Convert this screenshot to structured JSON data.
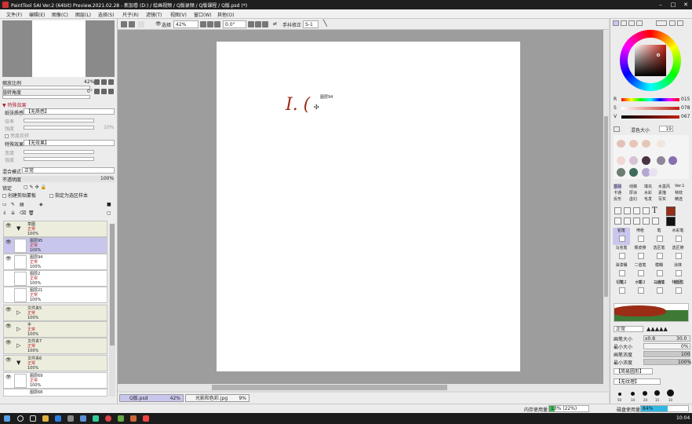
{
  "window": {
    "title": "PaintTool SAI Ver.2 (64bit) Preview.2021.02.28 - 新加卷 (D:) / 绘画视频 / Q版录频 / Q版课程 / Q版.psd (*)"
  },
  "menu": [
    "文件(F)",
    "编辑(E)",
    "图像(C)",
    "图层(L)",
    "选择(S)",
    "尺子(R)",
    "滤镜(T)",
    "视图(V)",
    "窗口(W)",
    "其他(O)"
  ],
  "navigator": {
    "zoom_label": "缩放比例",
    "zoom_value": "42%",
    "angle_label": "旋转角度",
    "angle_value": "0°"
  },
  "effects": {
    "section_title": "▼ 特殊效果",
    "paper_label": "纸张质感",
    "paper_value": "【无质感】",
    "scale_label": "倍率",
    "strength_label": "强度",
    "strength_value": "10%",
    "brightness_label": "亮度反转",
    "brightness_value": "100",
    "effect_label": "特殊效果",
    "effect_value": "【无效果】",
    "width_label": "宽度",
    "strength2_label": "强度"
  },
  "layer_props": {
    "blend_label": "混合模式",
    "blend_value": "正常",
    "opacity_label": "不透明度",
    "opacity_value": "100%",
    "lock_label": "锁定",
    "clip_label": "创建剪贴蒙板",
    "ref_label": "指定为选区样本"
  },
  "layers": [
    {
      "name": "草图",
      "mode": "正常",
      "opacity": "100%",
      "type": "folder"
    },
    {
      "name": "图层95",
      "mode": "正常",
      "opacity": "100%",
      "type": "selected"
    },
    {
      "name": "图层94",
      "mode": "正常",
      "opacity": "100%",
      "type": "layer"
    },
    {
      "name": "图层2",
      "mode": "正常",
      "opacity": "100%",
      "type": "layer"
    },
    {
      "name": "图层21",
      "mode": "正常",
      "opacity": "100%",
      "type": "layer"
    },
    {
      "name": "文件夹5",
      "mode": "正常",
      "opacity": "100%",
      "type": "folder"
    },
    {
      "name": "手",
      "mode": "正常",
      "opacity": "100%",
      "type": "folder"
    },
    {
      "name": "文件夹7",
      "mode": "正常",
      "opacity": "100%",
      "type": "folder"
    },
    {
      "name": "文件夹6",
      "mode": "正常",
      "opacity": "100%",
      "type": "folder"
    },
    {
      "name": "图层69",
      "mode": "正常",
      "opacity": "100%",
      "type": "layer"
    },
    {
      "name": "图层68",
      "mode": "",
      "opacity": "",
      "type": "layer"
    }
  ],
  "canvas_toolbar": {
    "select_label": "选择",
    "zoom": "42%",
    "angle": "0.0°",
    "stabilizer_label": "手抖修正",
    "stabilizer_value": "S-1"
  },
  "canvas": {
    "tooltip": "图层94",
    "sketch_text": "I. ("
  },
  "file_tabs": [
    {
      "name": "Q版.psd",
      "zoom": "42%"
    },
    {
      "name": "光影和色彩.jpg",
      "zoom": "9%"
    }
  ],
  "color": {
    "r_label": "R",
    "r_value": "015",
    "g_label": "S",
    "g_value": "078",
    "b_label": "V",
    "b_value": "067",
    "swatch_label": "混色大小",
    "swatch_value": "19",
    "main_color": "#9b2c15"
  },
  "tool_tabs": [
    "基础",
    "线稿",
    "填充",
    "水墨风",
    "Ver.1",
    "卡通",
    "厚涂",
    "水彩",
    "素描",
    "特效",
    "反形",
    "虚幻",
    "毛发",
    "写实",
    "精选"
  ],
  "brushes": [
    "铅笔",
    "喷枪",
    "笔",
    "水彩笔",
    "马克笔",
    "橡皮擦",
    "选区笔",
    "选区擦",
    "油漆桶",
    "二值笔",
    "模糊",
    "涂抹",
    "铅笔2",
    "水彩2",
    "马克2",
    "特效笔",
    "笔",
    "笔",
    "二值笔",
    "选区"
  ],
  "brush_settings": {
    "blend_value": "正常",
    "size_label": "画笔大小",
    "size_mult": "x0.8",
    "size_value": "30.0",
    "min_size_label": "最小大小",
    "min_size_value": "0%",
    "density_label": "画笔浓度",
    "density_value": "100",
    "min_density_label": "最小浓度",
    "min_density_value": "100%",
    "shape_value": "【简易圆形】",
    "texture_value": "【无纹理】",
    "dot_sizes": [
      "50",
      "14",
      "24",
      "15",
      "10"
    ]
  },
  "status": {
    "memory_label": "内存使用量",
    "memory_value": "13% (22%)",
    "disk_label": "磁盘使用量",
    "disk_value": "84%"
  },
  "taskbar": {
    "time": "10:04"
  }
}
